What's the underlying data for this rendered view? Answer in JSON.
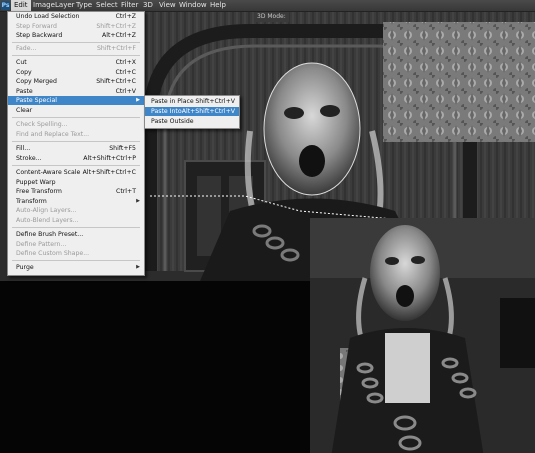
{
  "menubar": {
    "logo": "Ps",
    "items": [
      "Edit",
      "Image",
      "Layer",
      "Type",
      "Select",
      "Filter",
      "3D",
      "View",
      "Window",
      "Help"
    ],
    "active_item": "Edit",
    "mode_hint": "3D Mode:"
  },
  "edit_menu": {
    "undo_load_selection": {
      "label": "Undo Load Selection",
      "shortcut": "Ctrl+Z"
    },
    "step_forward": {
      "label": "Step Forward",
      "shortcut": "Shift+Ctrl+Z"
    },
    "step_backward": {
      "label": "Step Backward",
      "shortcut": "Alt+Ctrl+Z"
    },
    "fade": {
      "label": "Fade...",
      "shortcut": "Shift+Ctrl+F"
    },
    "cut": {
      "label": "Cut",
      "shortcut": "Ctrl+X"
    },
    "copy": {
      "label": "Copy",
      "shortcut": "Ctrl+C"
    },
    "copy_merged": {
      "label": "Copy Merged",
      "shortcut": "Shift+Ctrl+C"
    },
    "paste": {
      "label": "Paste",
      "shortcut": "Ctrl+V"
    },
    "paste_special": {
      "label": "Paste Special"
    },
    "clear": {
      "label": "Clear"
    },
    "check_spelling": {
      "label": "Check Spelling..."
    },
    "find_replace": {
      "label": "Find and Replace Text..."
    },
    "fill": {
      "label": "Fill...",
      "shortcut": "Shift+F5"
    },
    "stroke": {
      "label": "Stroke...",
      "shortcut": "Alt+Shift+Ctrl+P"
    },
    "content_aware_scale": {
      "label": "Content-Aware Scale",
      "shortcut": "Alt+Shift+Ctrl+C"
    },
    "puppet_warp": {
      "label": "Puppet Warp"
    },
    "free_transform": {
      "label": "Free Transform",
      "shortcut": "Ctrl+T"
    },
    "transform": {
      "label": "Transform"
    },
    "auto_align": {
      "label": "Auto-Align Layers..."
    },
    "auto_blend": {
      "label": "Auto-Blend Layers..."
    },
    "define_brush": {
      "label": "Define Brush Preset..."
    },
    "define_pattern": {
      "label": "Define Pattern..."
    },
    "define_custom_shape": {
      "label": "Define Custom Shape..."
    },
    "purge": {
      "label": "Purge"
    }
  },
  "paste_special_menu": {
    "paste_in_place": {
      "label": "Paste in Place",
      "shortcut": "Shift+Ctrl+V"
    },
    "paste_into": {
      "label": "Paste Into",
      "shortcut": "Alt+Shift+Ctrl+V"
    },
    "paste_outside": {
      "label": "Paste Outside"
    }
  },
  "colors": {
    "highlight": "#3f86c9",
    "menu_bg": "#efefef",
    "menubar_bg": "#424242"
  }
}
